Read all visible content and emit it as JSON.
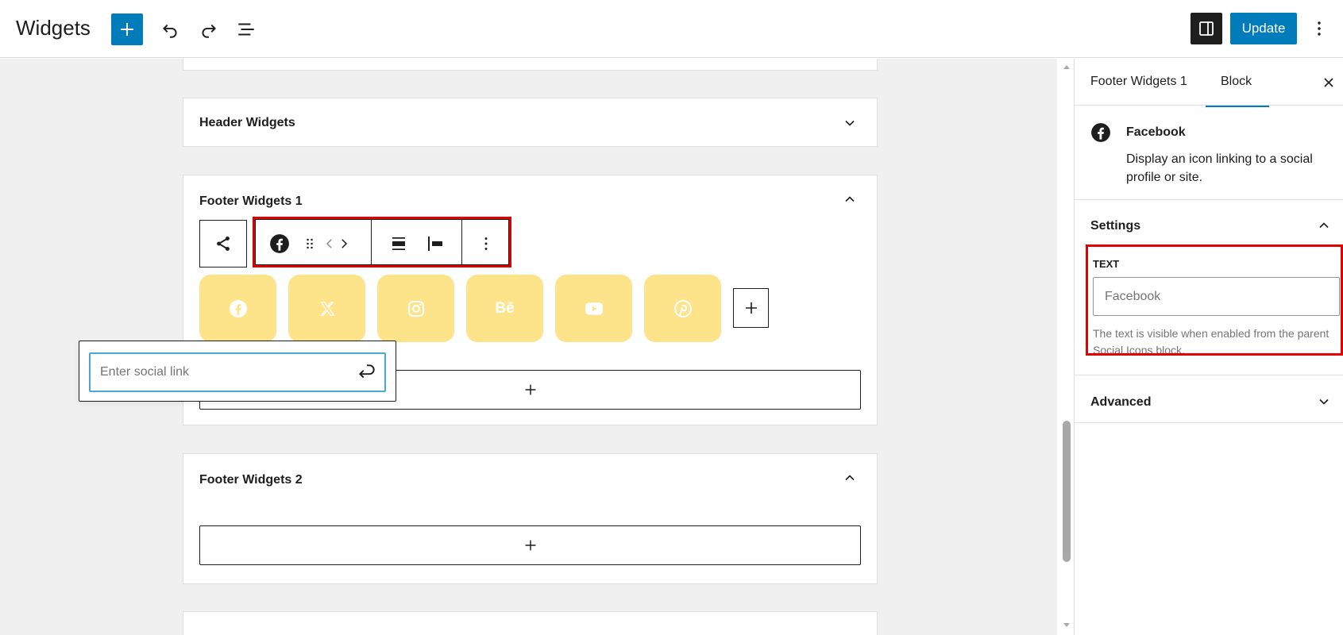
{
  "header": {
    "title": "Widgets",
    "update_label": "Update",
    "icons": {
      "add": "plus-icon",
      "undo": "undo-icon",
      "redo": "redo-icon",
      "list_view": "list-view-icon",
      "settings_toggle": "sidebar-toggle-icon",
      "more": "more-vertical-icon"
    }
  },
  "canvas": {
    "areas": [
      {
        "title": "Header Widgets",
        "state": "collapsed"
      },
      {
        "title": "Footer Widgets 1",
        "state": "expanded"
      },
      {
        "title": "Footer Widgets 2",
        "state": "expanded"
      }
    ],
    "social_icons": [
      "facebook-icon",
      "x-icon",
      "instagram-icon",
      "behance-icon",
      "youtube-icon",
      "pinterest-icon"
    ],
    "social_icon_color": "#fde38a",
    "behance_text": "Bē",
    "link_popover": {
      "placeholder": "Enter social link"
    }
  },
  "sidebar": {
    "tabs": [
      {
        "label": "Footer Widgets 1",
        "active": false
      },
      {
        "label": "Block",
        "active": true
      }
    ],
    "block": {
      "name": "Facebook",
      "description": "Display an icon linking to a social profile or site."
    },
    "settings": {
      "title": "Settings",
      "field_label": "TEXT",
      "field_placeholder": "Facebook",
      "help": "The text is visible when enabled from the parent Social Icons block."
    },
    "advanced": {
      "title": "Advanced"
    }
  },
  "colors": {
    "accent": "#007cba",
    "highlight": "#e00000"
  }
}
